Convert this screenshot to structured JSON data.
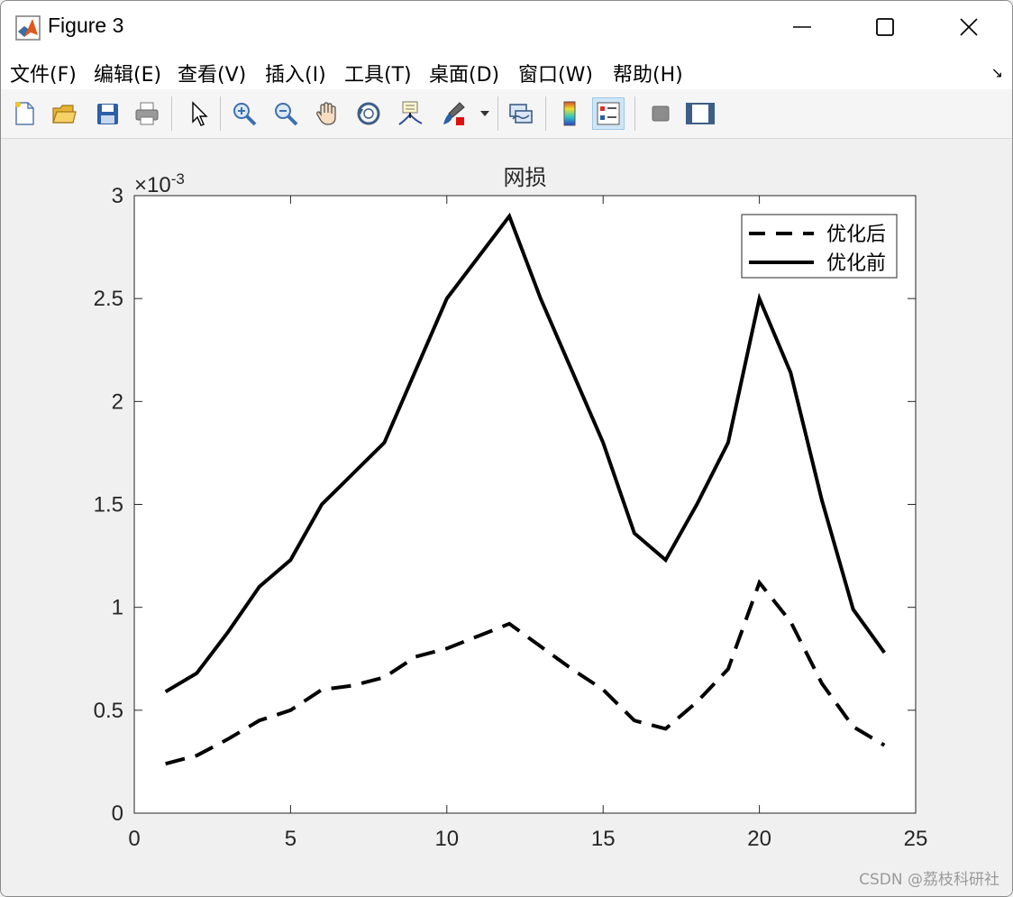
{
  "window": {
    "title": "Figure 3"
  },
  "menu": {
    "items": [
      "文件(F)",
      "编辑(E)",
      "查看(V)",
      "插入(I)",
      "工具(T)",
      "桌面(D)",
      "窗口(W)",
      "帮助(H)"
    ]
  },
  "toolbar": {
    "buttons": [
      "new-figure-icon",
      "open-file-icon",
      "save-icon",
      "print-icon",
      "pointer-icon",
      "zoom-in-icon",
      "zoom-out-icon",
      "pan-hand-icon",
      "rotate-3d-icon",
      "data-cursor-icon",
      "brush-icon",
      "link-plot-icon",
      "colorbar-icon",
      "legend-icon",
      "hide-tools-icon",
      "show-tools-icon"
    ],
    "active": "legend-icon"
  },
  "chart_data": {
    "type": "line",
    "title": "网损",
    "exponent_label": "×10",
    "exponent_power": "-3",
    "xlim": [
      0,
      25
    ],
    "ylim": [
      0,
      0.003
    ],
    "xticks": [
      "0",
      "5",
      "10",
      "15",
      "20",
      "25"
    ],
    "yticks": [
      "0",
      "0.5",
      "1",
      "1.5",
      "2",
      "2.5",
      "3"
    ],
    "grid": false,
    "legend_position": "top-right",
    "x": [
      1,
      2,
      3,
      4,
      5,
      6,
      7,
      8,
      9,
      10,
      11,
      12,
      13,
      14,
      15,
      16,
      17,
      18,
      19,
      20,
      21,
      22,
      23,
      24
    ],
    "series": [
      {
        "name": "优化后",
        "style": "dashed",
        "color": "#000000",
        "values": [
          0.00024,
          0.00028,
          0.00036,
          0.00045,
          0.0005,
          0.0006,
          0.00062,
          0.00066,
          0.00076,
          0.0008,
          0.00086,
          0.00092,
          0.00081,
          0.0007,
          0.0006,
          0.00045,
          0.00041,
          0.00054,
          0.0007,
          0.00112,
          0.00093,
          0.00063,
          0.00042,
          0.00033
        ]
      },
      {
        "name": "优化前",
        "style": "solid",
        "color": "#000000",
        "values": [
          0.00059,
          0.00068,
          0.00088,
          0.0011,
          0.00123,
          0.0015,
          0.00165,
          0.0018,
          0.00215,
          0.0025,
          0.0027,
          0.0029,
          0.0025,
          0.00215,
          0.0018,
          0.00136,
          0.00123,
          0.0015,
          0.0018,
          0.0025,
          0.00214,
          0.00152,
          0.00099,
          0.00078
        ]
      }
    ]
  },
  "watermark": "CSDN @荔枝科研社"
}
